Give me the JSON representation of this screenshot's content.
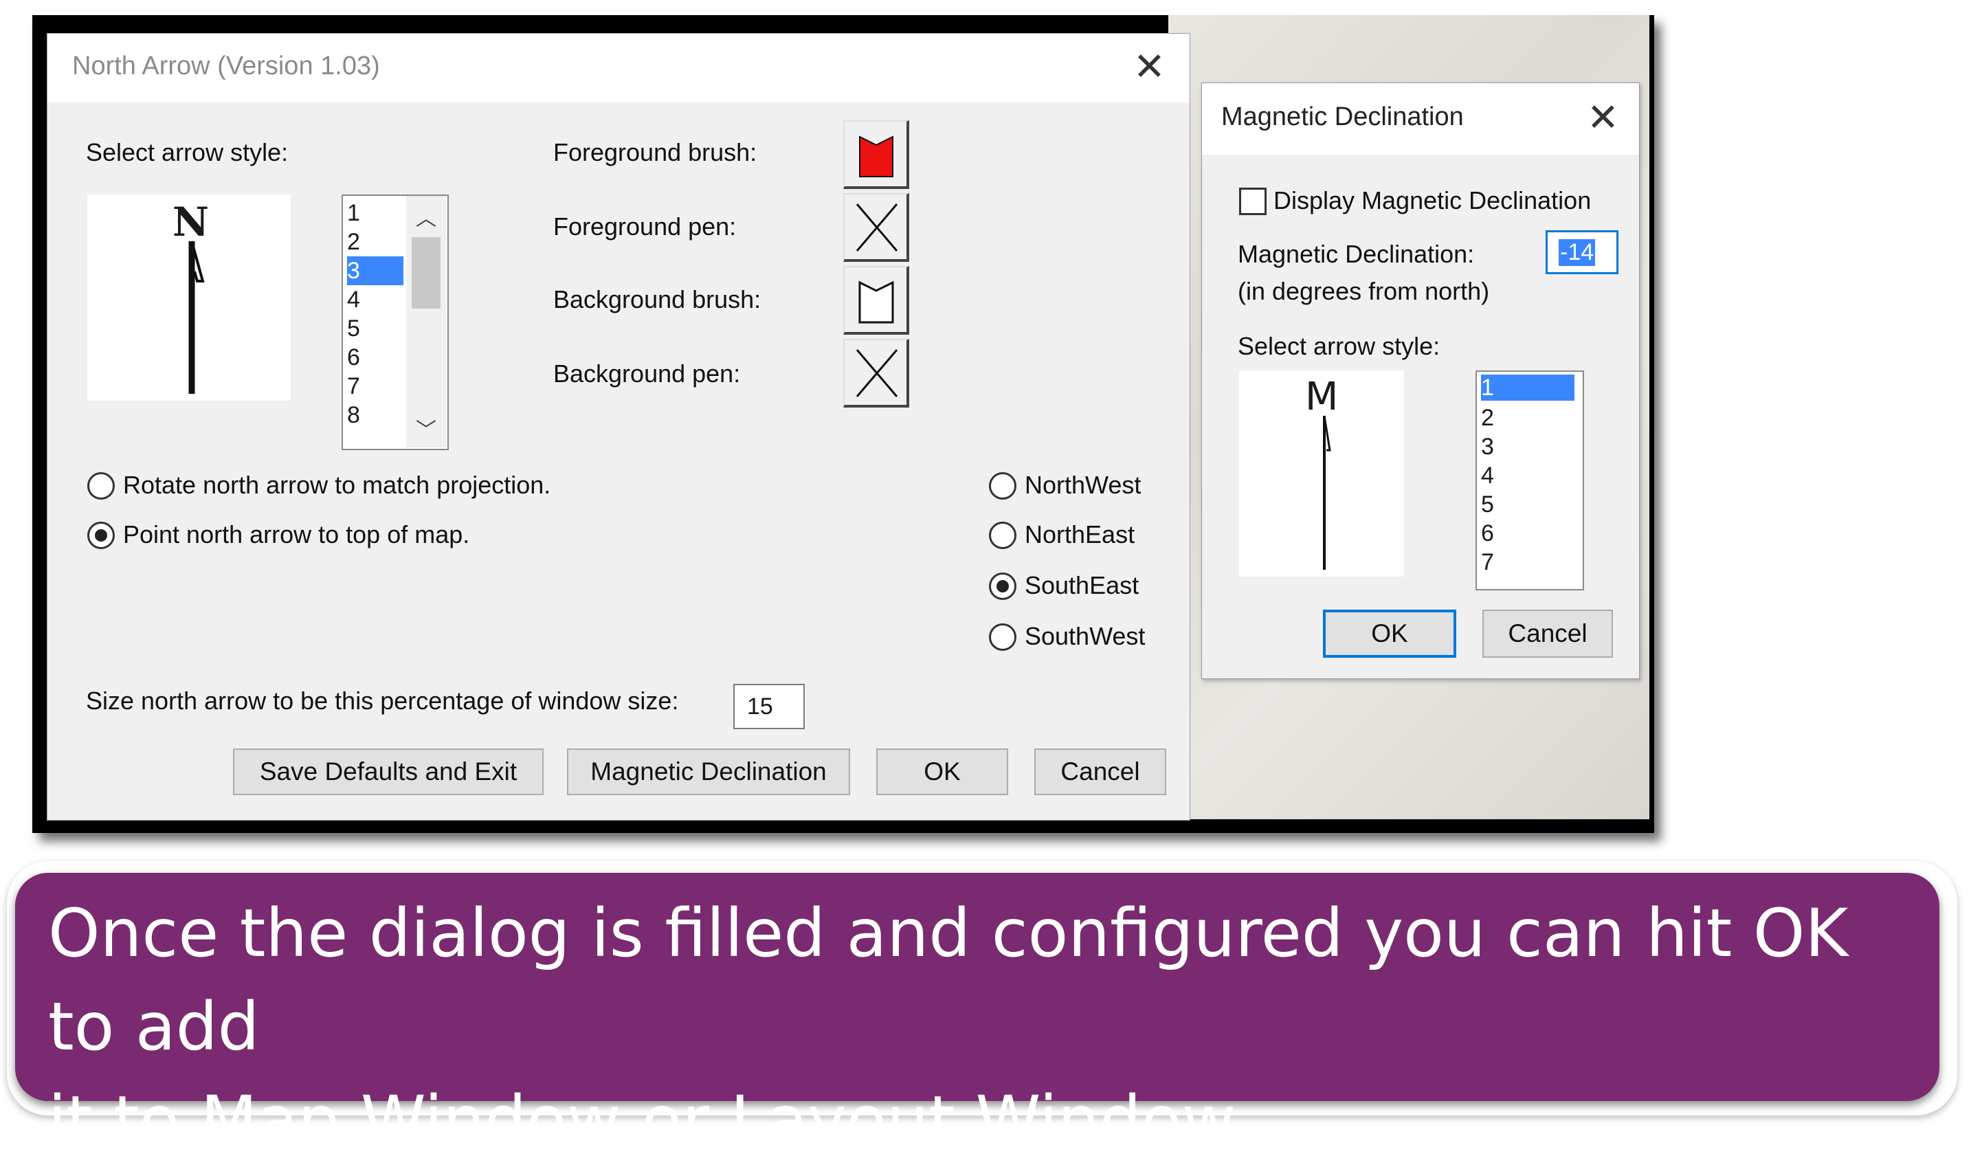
{
  "north_arrow_dialog": {
    "title": "North Arrow (Version 1.03)",
    "select_style_label": "Select arrow style:",
    "preview_letter": "N",
    "style_list": [
      "1",
      "2",
      "3",
      "4",
      "5",
      "6",
      "7",
      "8"
    ],
    "style_selected": "3",
    "foreground_brush_label": "Foreground brush:",
    "foreground_pen_label": "Foreground pen:",
    "background_brush_label": "Background brush:",
    "background_pen_label": "Background pen:",
    "rotate_option": "Rotate north arrow to match projection.",
    "point_option": "Point north arrow to top of map.",
    "orientation_selected": "Point north arrow to top of map.",
    "positions": [
      "NorthWest",
      "NorthEast",
      "SouthEast",
      "SouthWest"
    ],
    "position_selected": "SouthEast",
    "size_label": "Size north arrow to be this percentage of window size:",
    "size_value": "15",
    "buttons": {
      "save_defaults": "Save Defaults and Exit",
      "magnetic_declination": "Magnetic Declination",
      "ok": "OK",
      "cancel": "Cancel"
    },
    "foreground_brush_color": "#ee1111"
  },
  "magnetic_dialog": {
    "title": "Magnetic Declination",
    "display_checkbox_label": "Display Magnetic Declination",
    "display_checked": false,
    "declination_label": "Magnetic Declination:",
    "declination_sublabel": "(in degrees from north)",
    "declination_value": "-14",
    "select_style_label": "Select arrow style:",
    "preview_letter": "M",
    "style_list": [
      "1",
      "2",
      "3",
      "4",
      "5",
      "6",
      "7"
    ],
    "style_selected": "1",
    "ok": "OK",
    "cancel": "Cancel"
  },
  "caption": {
    "text": "Once the dialog is filled and configured you can hit OK to add\nit to Map Window or Layout Window",
    "background_color": "#7a2a70"
  }
}
